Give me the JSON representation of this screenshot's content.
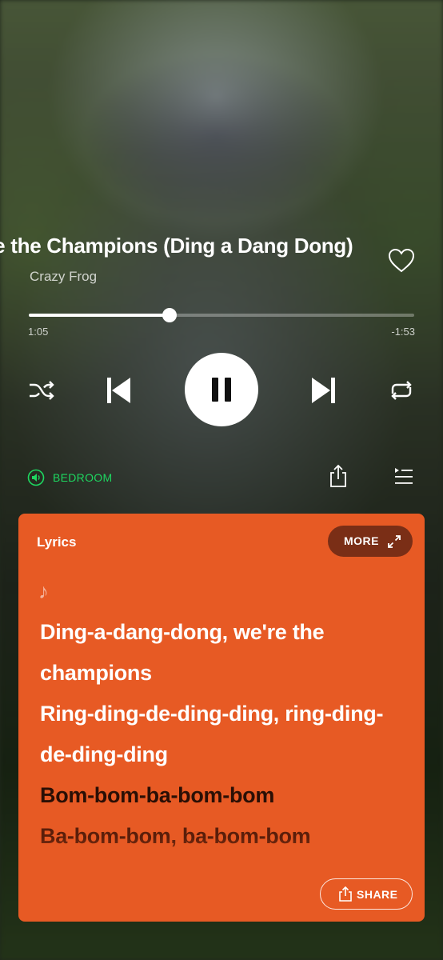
{
  "track": {
    "title": "We Are the Champions (Ding a Dang Dong)",
    "artist": "Crazy Frog",
    "liked": false
  },
  "playback": {
    "elapsed": "1:05",
    "remaining": "-1:53",
    "progress_fraction": 0.366,
    "state": "playing"
  },
  "controls": {
    "shuffle_icon": "shuffle-icon",
    "previous_icon": "skip-previous-icon",
    "play_pause_icon": "pause-icon",
    "next_icon": "skip-next-icon",
    "repeat_icon": "repeat-icon"
  },
  "device": {
    "label": "BEDROOM",
    "icon": "speaker-icon",
    "color": "#1ed760"
  },
  "lyrics": {
    "heading": "Lyrics",
    "more_label": "MORE",
    "share_label": "SHARE",
    "note_symbol": "♪",
    "card_color": "#e75a24",
    "lines": [
      {
        "text": "Ding-a-dang-dong, we're the",
        "state": "past"
      },
      {
        "text": "champions",
        "state": "past"
      },
      {
        "text": "Ring-ding-de-ding-ding, ring-ding-",
        "state": "past"
      },
      {
        "text": "de-ding-ding",
        "state": "past"
      },
      {
        "text": "Bom-bom-ba-bom-bom",
        "state": "current"
      },
      {
        "text": "Ba-bom-bom, ba-bom-bom",
        "state": "future"
      }
    ]
  }
}
